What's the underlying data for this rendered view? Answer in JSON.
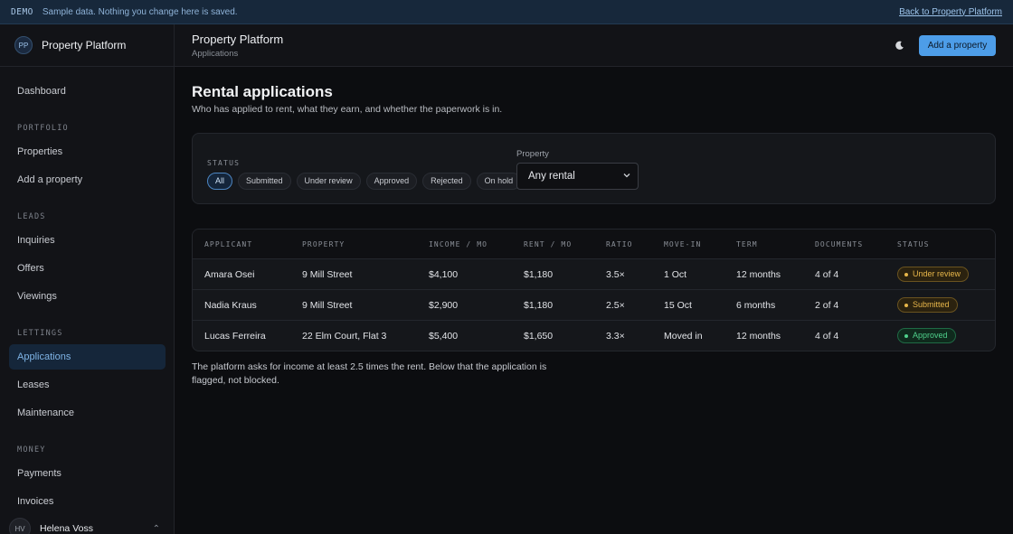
{
  "banner": {
    "tag": "DEMO",
    "message": "Sample data. Nothing you change here is saved.",
    "back_link": "Back to Property Platform"
  },
  "brand": {
    "initials": "PP",
    "name": "Property Platform"
  },
  "sidebar": {
    "dashboard": "Dashboard",
    "sections": {
      "portfolio": "PORTFOLIO",
      "leads": "LEADS",
      "lettings": "LETTINGS",
      "money": "MONEY"
    },
    "items": {
      "properties": "Properties",
      "add_property": "Add a property",
      "inquiries": "Inquiries",
      "offers": "Offers",
      "viewings": "Viewings",
      "applications": "Applications",
      "leases": "Leases",
      "maintenance": "Maintenance",
      "payments": "Payments",
      "invoices": "Invoices"
    },
    "active": "applications"
  },
  "user": {
    "initials": "HV",
    "name": "Helena Voss"
  },
  "header": {
    "title": "Property Platform",
    "subtitle": "Applications",
    "theme_icon": "moon-icon",
    "add_button": "Add a property"
  },
  "page": {
    "title": "Rental applications",
    "subtitle": "Who has applied to rent, what they earn, and whether the paperwork is in."
  },
  "filters": {
    "status_label": "STATUS",
    "status_options": [
      "All",
      "Submitted",
      "Under review",
      "Approved",
      "Rejected",
      "On hold"
    ],
    "status_selected": "All",
    "property_label": "Property",
    "property_value": "Any rental"
  },
  "table": {
    "columns": [
      "APPLICANT",
      "PROPERTY",
      "INCOME / MO",
      "RENT / MO",
      "RATIO",
      "MOVE-IN",
      "TERM",
      "DOCUMENTS",
      "STATUS"
    ],
    "rows": [
      {
        "applicant": "Amara Osei",
        "property": "9 Mill Street",
        "income": "$4,100",
        "rent": "$1,180",
        "ratio": "3.5×",
        "move_in": "1 Oct",
        "term": "12 months",
        "documents": "4 of 4",
        "status": "Under review"
      },
      {
        "applicant": "Nadia Kraus",
        "property": "9 Mill Street",
        "income": "$2,900",
        "rent": "$1,180",
        "ratio": "2.5×",
        "move_in": "15 Oct",
        "term": "6 months",
        "documents": "2 of 4",
        "status": "Submitted"
      },
      {
        "applicant": "Lucas Ferreira",
        "property": "22 Elm Court, Flat 3",
        "income": "$5,400",
        "rent": "$1,650",
        "ratio": "3.3×",
        "move_in": "Moved in",
        "term": "12 months",
        "documents": "4 of 4",
        "status": "Approved"
      }
    ]
  },
  "note": "The platform asks for income at least 2.5 times the rent. Below that the application is flagged, not blocked.",
  "colors": {
    "accent": "#4d9de8",
    "status_pending": "#e7b64a",
    "status_approved": "#4fd08b"
  }
}
